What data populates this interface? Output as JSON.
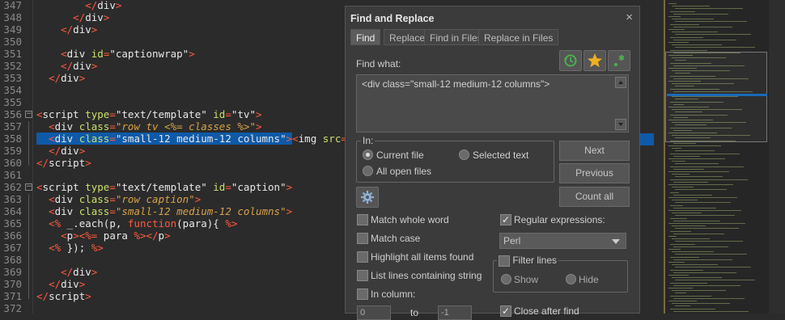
{
  "editor": {
    "lines": [
      {
        "n": "347",
        "html_parts": [
          [
            "",
            "        "
          ],
          [
            "br",
            "</"
          ],
          [
            "tag",
            "div"
          ],
          [
            "br",
            ">"
          ]
        ]
      },
      {
        "n": "348",
        "html_parts": [
          [
            "",
            "      "
          ],
          [
            "br",
            "</"
          ],
          [
            "tag",
            "div"
          ],
          [
            "br",
            ">"
          ]
        ]
      },
      {
        "n": "349",
        "html_parts": [
          [
            "",
            "    "
          ],
          [
            "br",
            "</"
          ],
          [
            "tag",
            "div"
          ],
          [
            "br",
            ">"
          ]
        ]
      },
      {
        "n": "350",
        "html_parts": []
      },
      {
        "n": "351",
        "html_parts": [
          [
            "",
            "    "
          ],
          [
            "br",
            "<"
          ],
          [
            "tag",
            "div "
          ],
          [
            "attr",
            "id"
          ],
          [
            "br",
            "="
          ],
          [
            "str",
            "\"captionwrap\""
          ],
          [
            "br",
            ">"
          ]
        ]
      },
      {
        "n": "352",
        "html_parts": [
          [
            "",
            "    "
          ],
          [
            "br",
            "</"
          ],
          [
            "tag",
            "div"
          ],
          [
            "br",
            ">"
          ]
        ]
      },
      {
        "n": "353",
        "html_parts": [
          [
            "",
            "  "
          ],
          [
            "br",
            "</"
          ],
          [
            "tag",
            "div"
          ],
          [
            "br",
            ">"
          ]
        ]
      },
      {
        "n": "354",
        "html_parts": []
      },
      {
        "n": "355",
        "html_parts": []
      },
      {
        "n": "356",
        "fold": "−",
        "html_parts": [
          [
            "br",
            "<"
          ],
          [
            "tag",
            "script "
          ],
          [
            "attr",
            "type"
          ],
          [
            "br",
            "="
          ],
          [
            "str",
            "\"text/template\" "
          ],
          [
            "attr",
            "id"
          ],
          [
            "br",
            "="
          ],
          [
            "str",
            "\"tv\""
          ],
          [
            "br",
            ">"
          ]
        ]
      },
      {
        "n": "357",
        "html_parts": [
          [
            "",
            "  "
          ],
          [
            "br",
            "<"
          ],
          [
            "tag",
            "div "
          ],
          [
            "attr",
            "class"
          ],
          [
            "br",
            "="
          ],
          [
            "ital",
            "\"row tv <%= classes %>\""
          ],
          [
            "br",
            ">"
          ]
        ]
      },
      {
        "n": "358",
        "highlight": true,
        "html_parts": [
          [
            "",
            "  "
          ],
          [
            "br",
            "<"
          ],
          [
            "tag",
            "div "
          ],
          [
            "attr",
            "class"
          ],
          [
            "br",
            "="
          ],
          [
            "str",
            "\"small-12 medium-12 columns\""
          ],
          [
            "br",
            ">"
          ],
          [
            "hl-end",
            ""
          ],
          [
            "br",
            "<"
          ],
          [
            "tag",
            "img "
          ],
          [
            "attr",
            "src"
          ],
          [
            "br",
            "="
          ],
          [
            "str",
            "\"<%="
          ]
        ]
      },
      {
        "n": "359",
        "html_parts": [
          [
            "",
            "  "
          ],
          [
            "br",
            "</"
          ],
          [
            "tag",
            "div"
          ],
          [
            "br",
            ">"
          ]
        ]
      },
      {
        "n": "360",
        "html_parts": [
          [
            "br",
            "</"
          ],
          [
            "tag",
            "script"
          ],
          [
            "br",
            ">"
          ]
        ]
      },
      {
        "n": "361",
        "html_parts": []
      },
      {
        "n": "362",
        "fold": "−",
        "html_parts": [
          [
            "br",
            "<"
          ],
          [
            "tag",
            "script "
          ],
          [
            "attr",
            "type"
          ],
          [
            "br",
            "="
          ],
          [
            "str",
            "\"text/template\" "
          ],
          [
            "attr",
            "id"
          ],
          [
            "br",
            "="
          ],
          [
            "str",
            "\"caption\""
          ],
          [
            "br",
            ">"
          ]
        ]
      },
      {
        "n": "363",
        "html_parts": [
          [
            "",
            "  "
          ],
          [
            "br",
            "<"
          ],
          [
            "tag",
            "div "
          ],
          [
            "attr",
            "class"
          ],
          [
            "br",
            "="
          ],
          [
            "ital",
            "\"row caption\""
          ],
          [
            "br",
            ">"
          ]
        ]
      },
      {
        "n": "364",
        "html_parts": [
          [
            "",
            "  "
          ],
          [
            "br",
            "<"
          ],
          [
            "tag",
            "div "
          ],
          [
            "attr",
            "class"
          ],
          [
            "br",
            "="
          ],
          [
            "ital",
            "\"small-12 medium-12 columns\""
          ],
          [
            "br",
            ">"
          ]
        ]
      },
      {
        "n": "365",
        "html_parts": [
          [
            "",
            "  "
          ],
          [
            "br",
            "<%"
          ],
          [
            "tag",
            " _.each(p, "
          ],
          [
            "br",
            "function"
          ],
          [
            "tag",
            "(para){ "
          ],
          [
            "br",
            "%>"
          ]
        ]
      },
      {
        "n": "366",
        "html_parts": [
          [
            "",
            "    "
          ],
          [
            "br",
            "<"
          ],
          [
            "tag",
            "p"
          ],
          [
            "br",
            "><%="
          ],
          [
            "tag",
            " para "
          ],
          [
            "br",
            "%></"
          ],
          [
            "tag",
            "p"
          ],
          [
            "br",
            ">"
          ]
        ]
      },
      {
        "n": "367",
        "html_parts": [
          [
            "",
            "  "
          ],
          [
            "br",
            "<%"
          ],
          [
            "tag",
            " }); "
          ],
          [
            "br",
            "%>"
          ]
        ]
      },
      {
        "n": "368",
        "html_parts": []
      },
      {
        "n": "369",
        "html_parts": [
          [
            "",
            "    "
          ],
          [
            "br",
            "</"
          ],
          [
            "tag",
            "div"
          ],
          [
            "br",
            ">"
          ]
        ]
      },
      {
        "n": "370",
        "html_parts": [
          [
            "",
            "  "
          ],
          [
            "br",
            "</"
          ],
          [
            "tag",
            "div"
          ],
          [
            "br",
            ">"
          ]
        ]
      },
      {
        "n": "371",
        "html_parts": [
          [
            "br",
            "</"
          ],
          [
            "tag",
            "script"
          ],
          [
            "br",
            ">"
          ]
        ]
      },
      {
        "n": "372",
        "html_parts": []
      }
    ]
  },
  "dialog": {
    "title": "Find and Replace",
    "close": "×",
    "tabs": [
      "Find",
      "Replace",
      "Find in Files",
      "Replace in Files"
    ],
    "find_what_label": "Find what:",
    "find_value": "<div class=\"small-12 medium-12 columns\">",
    "in_label": "In:",
    "scope": {
      "current_file": "Current file",
      "selected_text": "Selected text",
      "all_open_files": "All open files"
    },
    "buttons": {
      "next": "Next",
      "previous": "Previous",
      "count_all": "Count all"
    },
    "options": {
      "match_whole_word": "Match whole word",
      "match_case": "Match case",
      "highlight_all": "Highlight all items found",
      "list_lines": "List lines containing string",
      "in_column": "In column:",
      "regex": "Regular expressions:",
      "regex_flavor": "Perl",
      "filter_lines": "Filter lines",
      "show": "Show",
      "hide": "Hide",
      "close_after_find": "Close after find",
      "column_from": "0",
      "column_to_label": "to",
      "column_to": "-1"
    },
    "icons": {
      "history": "history-icon",
      "favorites": "star-icon",
      "regex": "regex-icon",
      "settings": "gear-icon"
    },
    "colors": {
      "history": "#4caf50",
      "star": "#f0b020",
      "regex": "#4caf50"
    }
  }
}
